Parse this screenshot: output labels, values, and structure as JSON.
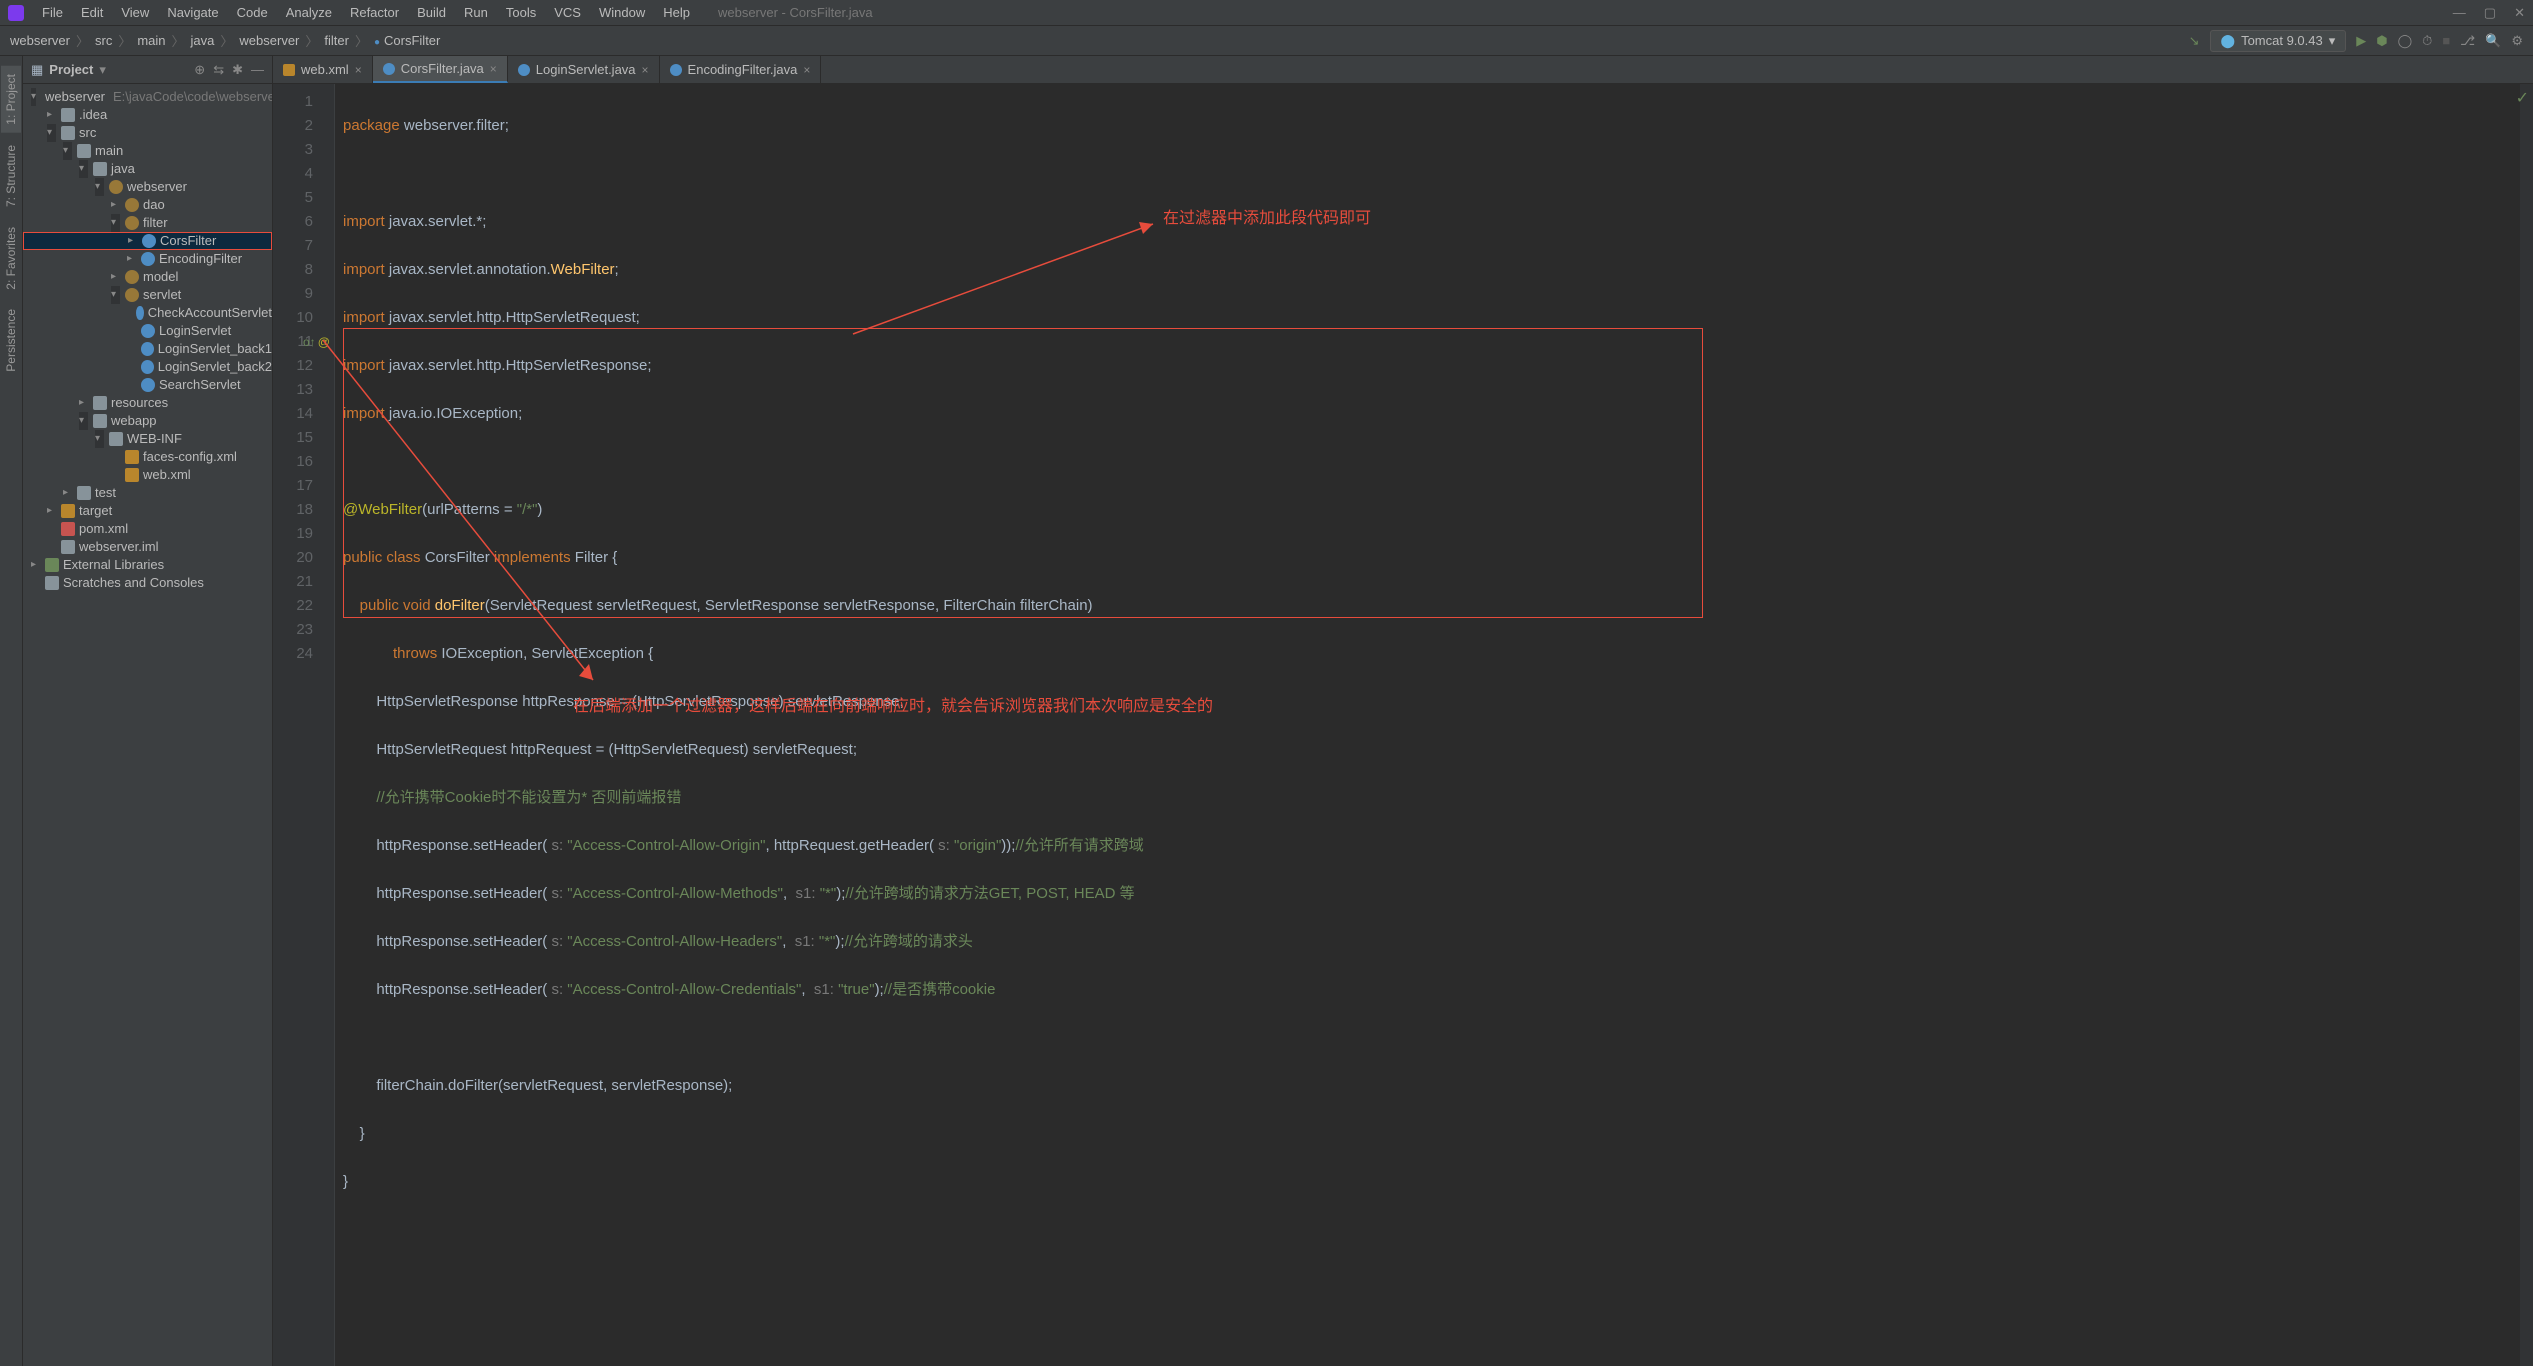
{
  "window": {
    "title": "webserver - CorsFilter.java"
  },
  "menu": [
    "File",
    "Edit",
    "View",
    "Navigate",
    "Code",
    "Analyze",
    "Refactor",
    "Build",
    "Run",
    "Tools",
    "VCS",
    "Window",
    "Help"
  ],
  "breadcrumbs": [
    "webserver",
    "src",
    "main",
    "java",
    "webserver",
    "filter",
    "CorsFilter"
  ],
  "run_config": "Tomcat 9.0.43",
  "project_panel": {
    "title": "Project"
  },
  "tree": [
    {
      "d": 0,
      "a": "fold",
      "i": "folder",
      "t": "webserver",
      "p": "E:\\javaCode\\code\\webserver"
    },
    {
      "d": 1,
      "a": "collapsed",
      "i": "folder",
      "t": ".idea"
    },
    {
      "d": 1,
      "a": "fold",
      "i": "folder",
      "t": "src"
    },
    {
      "d": 2,
      "a": "fold",
      "i": "folder",
      "t": "main"
    },
    {
      "d": 3,
      "a": "fold",
      "i": "folder",
      "t": "java"
    },
    {
      "d": 4,
      "a": "fold",
      "i": "pkg",
      "t": "webserver"
    },
    {
      "d": 5,
      "a": "collapsed",
      "i": "pkg",
      "t": "dao"
    },
    {
      "d": 5,
      "a": "fold",
      "i": "pkg",
      "t": "filter"
    },
    {
      "d": 6,
      "a": "collapsed",
      "i": "cls",
      "t": "CorsFilter",
      "sel": true
    },
    {
      "d": 6,
      "a": "collapsed",
      "i": "cls",
      "t": "EncodingFilter"
    },
    {
      "d": 5,
      "a": "collapsed",
      "i": "pkg",
      "t": "model"
    },
    {
      "d": 5,
      "a": "fold",
      "i": "pkg",
      "t": "servlet"
    },
    {
      "d": 6,
      "a": "none",
      "i": "cls",
      "t": "CheckAccountServlet"
    },
    {
      "d": 6,
      "a": "none",
      "i": "cls",
      "t": "LoginServlet"
    },
    {
      "d": 6,
      "a": "none",
      "i": "cls",
      "t": "LoginServlet_back1"
    },
    {
      "d": 6,
      "a": "none",
      "i": "cls",
      "t": "LoginServlet_back2"
    },
    {
      "d": 6,
      "a": "none",
      "i": "cls",
      "t": "SearchServlet"
    },
    {
      "d": 3,
      "a": "collapsed",
      "i": "folder",
      "t": "resources"
    },
    {
      "d": 3,
      "a": "fold",
      "i": "folder",
      "t": "webapp"
    },
    {
      "d": 4,
      "a": "fold",
      "i": "folder",
      "t": "WEB-INF"
    },
    {
      "d": 5,
      "a": "none",
      "i": "xml",
      "t": "faces-config.xml"
    },
    {
      "d": 5,
      "a": "none",
      "i": "xml",
      "t": "web.xml"
    },
    {
      "d": 2,
      "a": "collapsed",
      "i": "folder",
      "t": "test"
    },
    {
      "d": 1,
      "a": "collapsed",
      "i": "folder-o",
      "t": "target"
    },
    {
      "d": 1,
      "a": "none",
      "i": "mvn",
      "t": "pom.xml"
    },
    {
      "d": 1,
      "a": "none",
      "i": "folder",
      "t": "webserver.iml"
    },
    {
      "d": 0,
      "a": "collapsed",
      "i": "lib",
      "t": "External Libraries"
    },
    {
      "d": 0,
      "a": "none",
      "i": "folder",
      "t": "Scratches and Consoles"
    }
  ],
  "tabs": [
    {
      "label": "web.xml",
      "icon": "xml"
    },
    {
      "label": "CorsFilter.java",
      "icon": "cls",
      "active": true
    },
    {
      "label": "LoginServlet.java",
      "icon": "cls"
    },
    {
      "label": "EncodingFilter.java",
      "icon": "cls"
    }
  ],
  "code_lines": [
    1,
    2,
    3,
    4,
    5,
    6,
    7,
    8,
    9,
    10,
    11,
    12,
    13,
    14,
    15,
    16,
    17,
    18,
    19,
    20,
    21,
    22,
    23,
    24
  ],
  "annotations": {
    "top": "在过滤器中添加此段代码即可",
    "bottom": "在后端添加一个过滤器，这样后端在向前端响应时，就会告诉浏览器我们本次响应是安全的"
  },
  "left_tabs": [
    "1: Project",
    "7: Structure",
    "2: Favorites",
    "Persistence"
  ]
}
